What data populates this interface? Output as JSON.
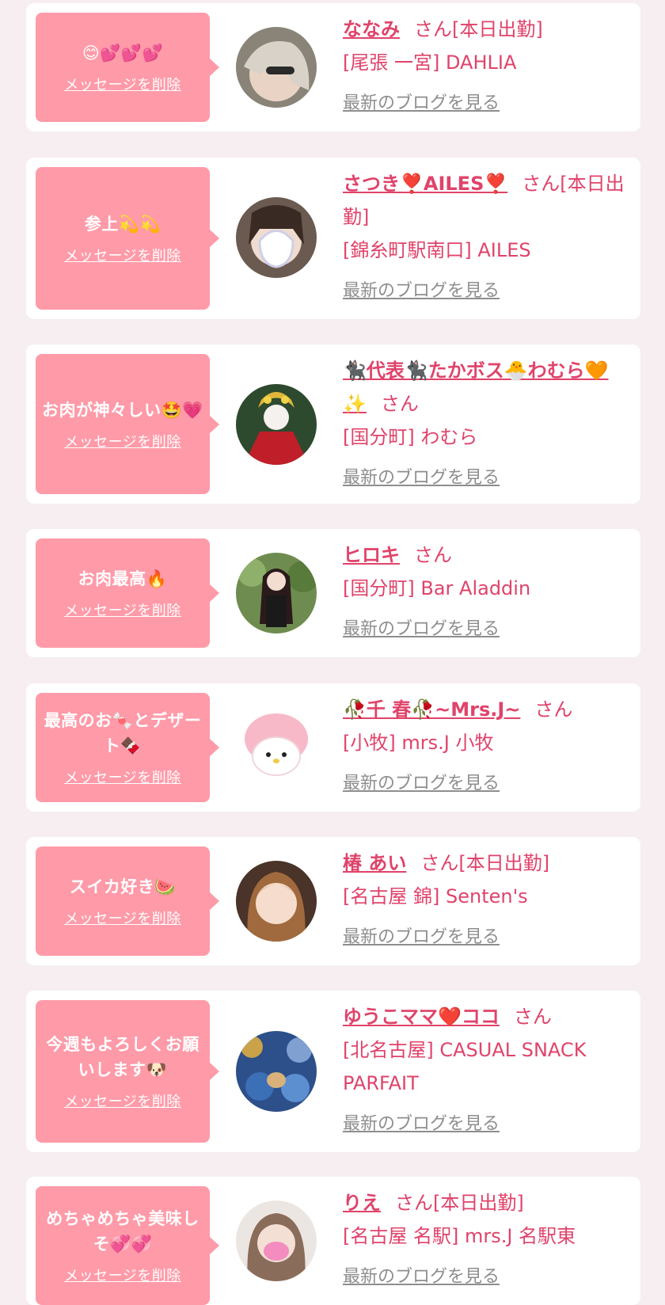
{
  "items": [
    {
      "message": "😊💕💕💕",
      "delete_label": "メッセージを削除",
      "name": "ななみ",
      "honorific": "さん[本日出勤]",
      "shop": "[尾張 一宮] DAHLIA",
      "blog_label": "最新のブログを見る"
    },
    {
      "message": "参上💫💫",
      "delete_label": "メッセージを削除",
      "name": "さつき❣️AILES❣️",
      "honorific": "さん[本日出勤]",
      "shop": "[錦糸町駅南口] AILES",
      "blog_label": "最新のブログを見る"
    },
    {
      "message": "お肉が神々しい🤩💗",
      "delete_label": "メッセージを削除",
      "name": "🐈‍⬛代表🐈‍⬛たかボス🐣わむら🧡✨",
      "honorific": "さん",
      "shop": "[国分町] わむら",
      "blog_label": "最新のブログを見る"
    },
    {
      "message": "お肉最高🔥",
      "delete_label": "メッセージを削除",
      "name": "ヒロキ",
      "honorific": "さん",
      "shop": "[国分町] Bar Aladdin",
      "blog_label": "最新のブログを見る"
    },
    {
      "message": "最高のお🍬とデザート🍫",
      "delete_label": "メッセージを削除",
      "name": "🥀千 春🥀~Mrs.J~",
      "honorific": "さん",
      "shop": "[小牧] mrs.J 小牧",
      "blog_label": "最新のブログを見る"
    },
    {
      "message": "スイカ好き🍉",
      "delete_label": "メッセージを削除",
      "name": "椿 あい",
      "honorific": "さん[本日出勤]",
      "shop": "[名古屋 錦] Senten's",
      "blog_label": "最新のブログを見る"
    },
    {
      "message": "今週もよろしくお願いします🐶",
      "delete_label": "メッセージを削除",
      "name": "ゆうこママ❤️ココ",
      "honorific": "さん",
      "shop": "[北名古屋] CASUAL SNACK PARFAIT",
      "blog_label": "最新のブログを見る"
    },
    {
      "message": "めちゃめちゃ美味しそ💞💞",
      "delete_label": "メッセージを削除",
      "name": "りえ",
      "honorific": "さん[本日出勤]",
      "shop": "[名古屋 名駅] mrs.J 名駅東",
      "blog_label": "最新のブログを見る"
    }
  ]
}
